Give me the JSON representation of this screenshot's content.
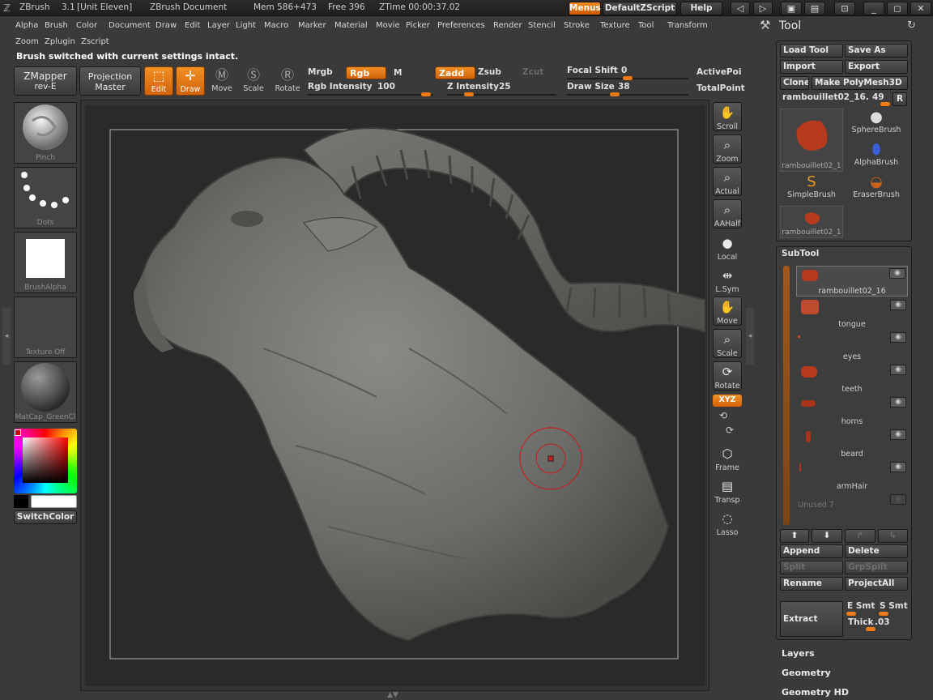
{
  "app": {
    "name": "ZBrush",
    "version": "3.1",
    "project": "[Unit Eleven]",
    "document": "ZBrush Document",
    "mem": "Mem 586+473",
    "free": "Free 396",
    "ztime": "ZTime 00:00:37.02"
  },
  "titlebar": {
    "menus_label": "Menus",
    "zscript_label": "DefaultZScript",
    "help_label": "Help"
  },
  "menus": {
    "row1": [
      "Alpha",
      "Brush",
      "Color",
      "Document",
      "Draw",
      "Edit",
      "Layer",
      "Light",
      "Macro",
      "Marker",
      "Material",
      "Movie",
      "Picker",
      "Preferences",
      "Render",
      "Stencil",
      "Stroke",
      "Texture",
      "Tool",
      "Transform"
    ],
    "row2": [
      "Zoom",
      "Zplugin",
      "Zscript"
    ]
  },
  "status_message": "Brush switched with current settings intact.",
  "toolbar": {
    "zmapper": "ZMapper",
    "zmapper_sub": "rev-E",
    "projection": "Projection",
    "projection_sub": "Master",
    "modes": [
      "Edit",
      "Draw",
      "Move",
      "Scale",
      "Rotate"
    ],
    "mrgb": "Mrgb",
    "rgb": "Rgb",
    "m": "M",
    "zadd": "Zadd",
    "zsub": "Zsub",
    "zcut": "Zcut",
    "rgb_intensity_label": "Rgb Intensity",
    "rgb_intensity": "100",
    "z_intensity_label": "Z Intensity",
    "z_intensity": "25",
    "focal_shift_label": "Focal Shift",
    "focal_shift": "0",
    "draw_size_label": "Draw Size",
    "draw_size": "38",
    "active_points": "ActivePoi",
    "total_points": "TotalPoint"
  },
  "shelf": {
    "brush": "Pinch",
    "stroke": "Dots",
    "alpha": "BrushAlpha",
    "texture": "Texture Off",
    "material": "MatCap_GreenCl",
    "switch_color": "SwitchColor"
  },
  "right_strip": [
    "Scroll",
    "Zoom",
    "Actual",
    "AAHalf",
    "Local",
    "L.Sym",
    "Move",
    "Scale",
    "Rotate",
    "XYZ",
    "Frame",
    "Transp",
    "Lasso"
  ],
  "tool_panel": {
    "title": "Tool",
    "load_tool": "Load Tool",
    "save_as": "Save As",
    "import": "Import",
    "export": "Export",
    "clone": "Clone",
    "make_polymesh": "Make PolyMesh3D",
    "current_tool": "rambouillet02_16.",
    "current_tool_value": "49",
    "r_label": "R",
    "thumbs": [
      "rambouillet02_1",
      "SphereBrush",
      "AlphaBrush",
      "SimpleBrush",
      "EraserBrush",
      "rambouillet02_1"
    ]
  },
  "subtool": {
    "title": "SubTool",
    "items": [
      "rambouillet02_16",
      "tongue",
      "eyes",
      "teeth",
      "horns",
      "beard",
      "armHair",
      "Unused 7"
    ],
    "append": "Append",
    "delete": "Delete",
    "split": "Split",
    "grpsplit": "GrpSplit",
    "rename": "Rename",
    "projectall": "ProjectAll",
    "extract": "Extract",
    "e_smt": "E Smt",
    "s_smt": "S Smt",
    "thick": "Thick",
    "thick_value": ".03"
  },
  "sections": [
    "Layers",
    "Geometry",
    "Geometry HD"
  ]
}
